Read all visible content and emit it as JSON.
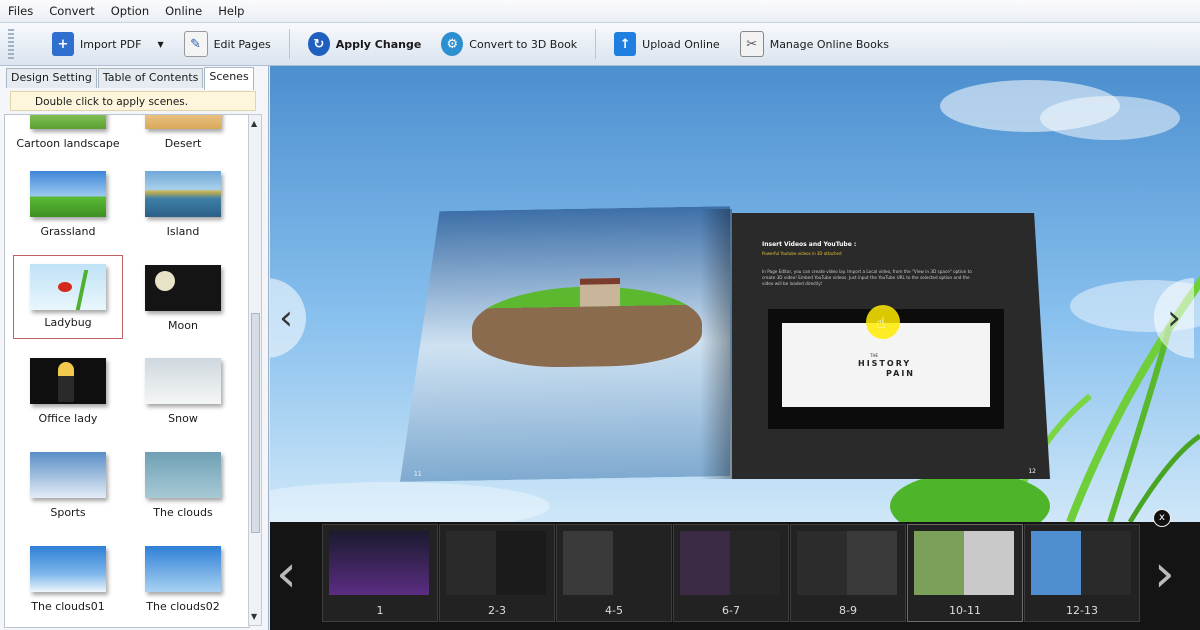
{
  "menu": [
    "Files",
    "Convert",
    "Option",
    "Online",
    "Help"
  ],
  "toolbar": {
    "import_pdf": "Import PDF",
    "edit_pages": "Edit Pages",
    "apply_change": "Apply Change",
    "convert_3d": "Convert to 3D Book",
    "upload_online": "Upload Online",
    "manage_online": "Manage Online Books"
  },
  "tabs": [
    "Design Setting",
    "Table of Contents",
    "Scenes"
  ],
  "hint": "Double click to apply scenes.",
  "scenes": [
    "Cartoon landscape",
    "Desert",
    "Grassland",
    "Island",
    "Ladybug",
    "Moon",
    "Office lady",
    "Snow",
    "Sports",
    "The clouds",
    "The clouds01",
    "The clouds02"
  ],
  "book": {
    "right_heading": "Insert Videos and YouTube :",
    "right_subheading": "Powerful Youtube videos in 3D attached",
    "right_body": "In Page Editor, you can create video lay. Import a Local video, from the \"View in 3D space\" option to create 3D video! Embed YouTube videos. Just input the YouTube URL to the selected option and the video will be loaded directly!",
    "video_title_small": "THE",
    "video_title_1": "HISTORY",
    "video_title_2": "PAIN",
    "page_left_num": "11",
    "page_right_num": "12"
  },
  "pages": [
    "1",
    "2-3",
    "4-5",
    "6-7",
    "8-9",
    "10-11",
    "12-13"
  ],
  "close_label": "x"
}
